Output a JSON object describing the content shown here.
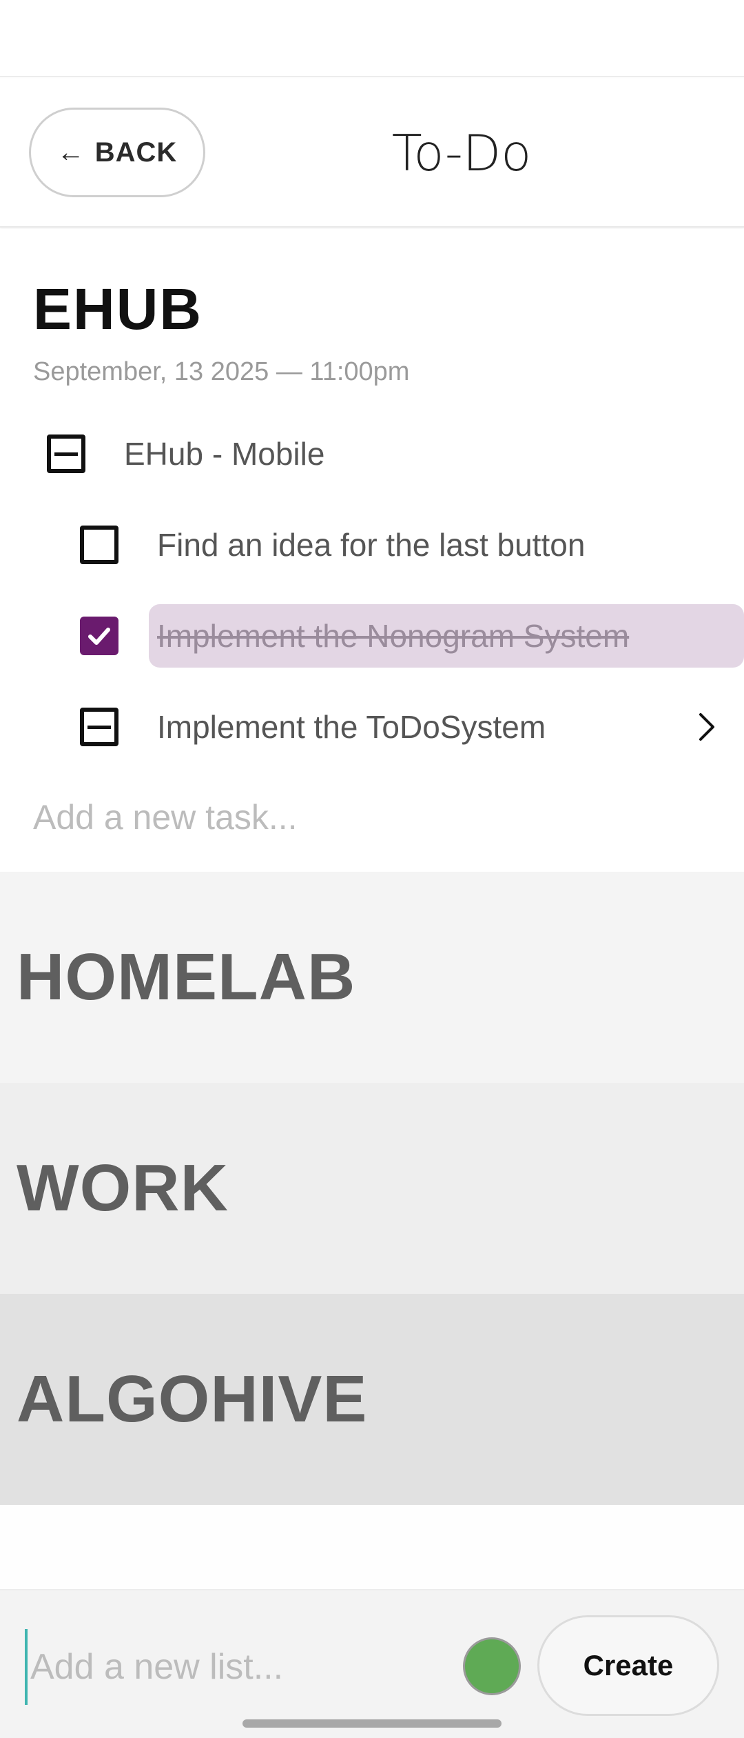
{
  "header": {
    "back_arrow": "←",
    "back_label": "BACK",
    "title": "To-Do"
  },
  "open_list": {
    "title": "EHUB",
    "date": "September, 13 2025  —  11:00pm",
    "tasks": [
      {
        "label": "EHub - Mobile",
        "state": "indeterminate"
      },
      {
        "label": "Find an idea for the last button",
        "state": "unchecked"
      },
      {
        "label": "Implement the Nonogram System",
        "state": "checked"
      },
      {
        "label": "Implement the ToDoSystem",
        "state": "indeterminate",
        "has_subtasks": true
      }
    ],
    "add_task_placeholder": "Add a new task..."
  },
  "collapsed_lists": [
    {
      "title": "HOMELAB",
      "color": "#f4f4f4"
    },
    {
      "title": "WORK",
      "color": "#eeeeee"
    },
    {
      "title": "ALGOHIVE",
      "color": "#e1e1e1"
    }
  ],
  "bottom_bar": {
    "add_list_placeholder": "Add a new list...",
    "selected_color": "#5faa55",
    "create_label": "Create"
  },
  "colors": {
    "accent_checked": "#6a1b6e",
    "highlight": "#e3d6e4",
    "cursor": "#3fb5b0"
  },
  "icons": {
    "back": "left-arrow-icon",
    "subtasks": "chevron-right-icon",
    "check": "check-icon"
  }
}
